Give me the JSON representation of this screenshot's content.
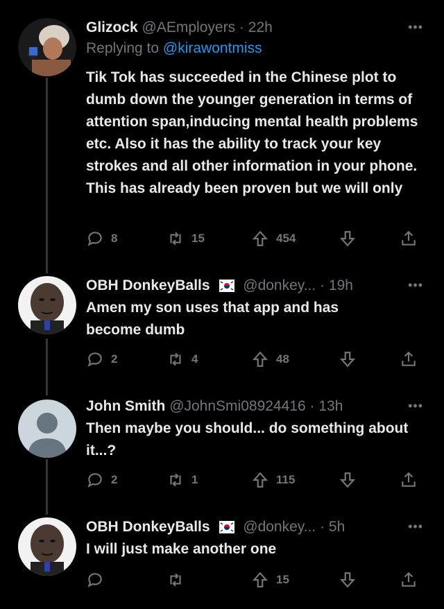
{
  "tweets": [
    {
      "name": "Glizock",
      "handle": "@AEmployers",
      "dot": "·",
      "time": "22h",
      "reply_prefix": "Replying to ",
      "reply_to": "@kirawontmiss",
      "text": "Tik Tok has succeeded in the Chinese plot to dumb down the younger generation in terms of attention span,inducing mental health problems etc. Also it has the ability to track your key strokes and all other information in your phone. This has already been proven but we will only",
      "replies": "8",
      "retweets": "15",
      "upvotes": "454"
    },
    {
      "name": "OBH DonkeyBalls",
      "handle": "@donkey...",
      "dot": "·",
      "time": "19h",
      "text": "Amen my son uses that app and has become dumb",
      "replies": "2",
      "retweets": "4",
      "upvotes": "48"
    },
    {
      "name": "John Smith",
      "handle": "@JohnSmi08924416",
      "dot": "·",
      "time": "13h",
      "text": "Then maybe you should... do something about it...?",
      "replies": "2",
      "retweets": "1",
      "upvotes": "115"
    },
    {
      "name": "OBH DonkeyBalls",
      "handle": "@donkey...",
      "dot": "·",
      "time": "5h",
      "text": "I will just make another one",
      "replies": "",
      "retweets": "",
      "upvotes": "15"
    }
  ],
  "more_label": "•••",
  "colors": {
    "background": "#000000",
    "text": "#e7e9ea",
    "muted": "#71767b",
    "link": "#1d9bf0",
    "line": "#333639"
  },
  "icons": [
    "reply-icon",
    "retweet-icon",
    "upvote-icon",
    "downvote-icon",
    "share-icon",
    "more-icon",
    "korea-flag-icon"
  ]
}
